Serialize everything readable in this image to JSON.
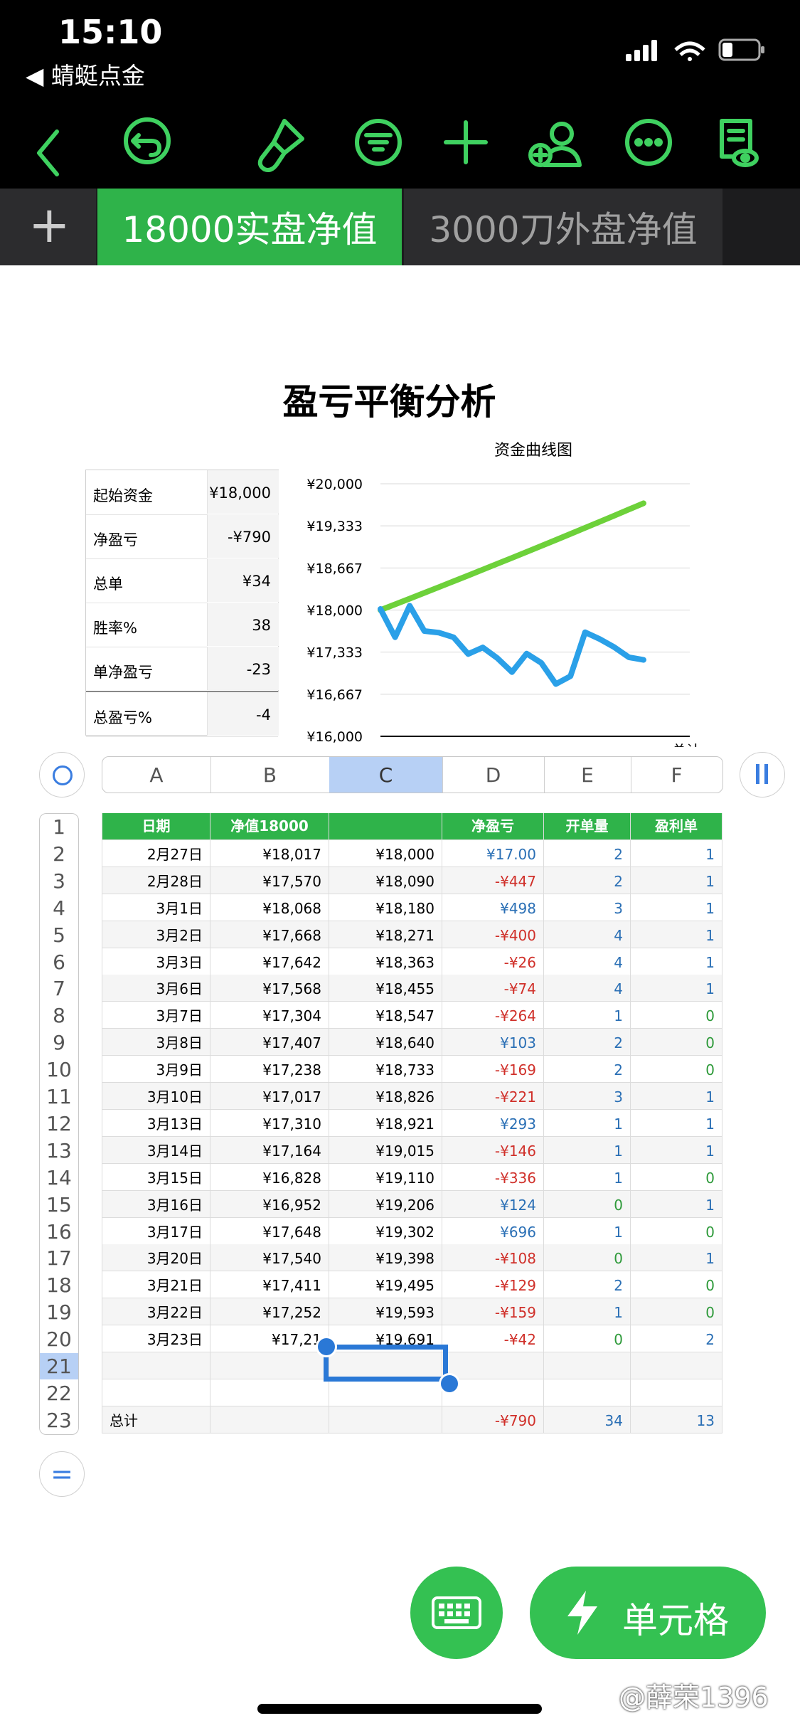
{
  "status": {
    "time": "15:10",
    "back_app": "◀ 蜻蜓点金"
  },
  "toolbar": {
    "icons": [
      "back-chevron-icon",
      "undo-icon",
      "paintbrush-icon",
      "filter-icon",
      "add-icon",
      "collaborate-icon",
      "more-icon",
      "reader-view-icon"
    ]
  },
  "tabs": {
    "add": "+",
    "active": "18000实盘净值",
    "other": "3000刀外盘净值"
  },
  "sheet_title": "盈亏平衡分析",
  "summary": {
    "rows": [
      {
        "label": "起始资金",
        "value": "¥18,000"
      },
      {
        "label": "净盈亏",
        "value": "-¥790"
      },
      {
        "label": "总单",
        "value": "¥34"
      },
      {
        "label": "胜率%",
        "value": "38"
      },
      {
        "label": "单净盈亏",
        "value": "-23"
      },
      {
        "label": "总盈亏%",
        "value": "-4"
      }
    ]
  },
  "chart_data": {
    "type": "line",
    "title": "资金曲线图",
    "y_ticks": [
      "¥20,000",
      "¥19,333",
      "¥18,667",
      "¥18,000",
      "¥17,333",
      "¥16,667",
      "¥16,000"
    ],
    "ylim": [
      16000,
      20000
    ],
    "x_tick_partial": "总计",
    "series": [
      {
        "values": [
          18000,
          18090,
          18180,
          18271,
          18363,
          18455,
          18547,
          18640,
          18733,
          18826,
          18921,
          19015,
          19110,
          19206,
          19302,
          19398,
          19495,
          19593,
          19691
        ],
        "color": "#6dd13a"
      },
      {
        "values": [
          18017,
          17570,
          18068,
          17668,
          17642,
          17568,
          17304,
          17407,
          17238,
          17017,
          17310,
          17164,
          16828,
          16952,
          17648,
          17540,
          17411,
          17252,
          17210
        ],
        "color": "#2aa0e8"
      }
    ]
  },
  "columns": [
    "A",
    "B",
    "C",
    "D",
    "E",
    "F"
  ],
  "selected_column": "C",
  "row_numbers": [
    "1",
    "2",
    "3",
    "4",
    "5",
    "6",
    "7",
    "8",
    "9",
    "10",
    "11",
    "12",
    "13",
    "14",
    "15",
    "16",
    "17",
    "18",
    "19",
    "20",
    "21",
    "22",
    "23"
  ],
  "selected_row": "21",
  "grid": {
    "header": [
      "日期",
      "净值18000",
      "",
      "净盈亏",
      "开单量",
      "盈利单"
    ],
    "rows": [
      [
        "2月27日",
        "¥18,017",
        "¥18,000",
        "¥17.00",
        "2",
        "1"
      ],
      [
        "2月28日",
        "¥17,570",
        "¥18,090",
        "-¥447",
        "2",
        "1"
      ],
      [
        "3月1日",
        "¥18,068",
        "¥18,180",
        "¥498",
        "3",
        "1"
      ],
      [
        "3月2日",
        "¥17,668",
        "¥18,271",
        "-¥400",
        "4",
        "1"
      ],
      [
        "3月3日",
        "¥17,642",
        "¥18,363",
        "-¥26",
        "4",
        "1"
      ],
      [
        "3月6日",
        "¥17,568",
        "¥18,455",
        "-¥74",
        "4",
        "1"
      ],
      [
        "3月7日",
        "¥17,304",
        "¥18,547",
        "-¥264",
        "1",
        "0"
      ],
      [
        "3月8日",
        "¥17,407",
        "¥18,640",
        "¥103",
        "2",
        "0"
      ],
      [
        "3月9日",
        "¥17,238",
        "¥18,733",
        "-¥169",
        "2",
        "0"
      ],
      [
        "3月10日",
        "¥17,017",
        "¥18,826",
        "-¥221",
        "3",
        "1"
      ],
      [
        "3月13日",
        "¥17,310",
        "¥18,921",
        "¥293",
        "1",
        "1"
      ],
      [
        "3月14日",
        "¥17,164",
        "¥19,015",
        "-¥146",
        "1",
        "1"
      ],
      [
        "3月15日",
        "¥16,828",
        "¥19,110",
        "-¥336",
        "1",
        "0"
      ],
      [
        "3月16日",
        "¥16,952",
        "¥19,206",
        "¥124",
        "0",
        "1"
      ],
      [
        "3月17日",
        "¥17,648",
        "¥19,302",
        "¥696",
        "1",
        "0"
      ],
      [
        "3月20日",
        "¥17,540",
        "¥19,398",
        "-¥108",
        "0",
        "1"
      ],
      [
        "3月21日",
        "¥17,411",
        "¥19,495",
        "-¥129",
        "2",
        "0"
      ],
      [
        "3月22日",
        "¥17,252",
        "¥19,593",
        "-¥159",
        "1",
        "0"
      ],
      [
        "3月23日",
        "¥17,21",
        "¥19,691",
        "-¥42",
        "0",
        "2"
      ],
      [
        "",
        "",
        "",
        "",
        "",
        ""
      ],
      [
        "",
        "",
        "",
        "",
        "",
        ""
      ],
      [
        "总计",
        "",
        "",
        "-¥790",
        "34",
        "13"
      ]
    ]
  },
  "bottom": {
    "cell_button": "单元格",
    "watermark": "@薛荣1396"
  },
  "colors": {
    "accent_green": "#2fb34a",
    "negative": "#d0302a",
    "positive": "#2a6fb5",
    "selection": "#2a78d6"
  }
}
